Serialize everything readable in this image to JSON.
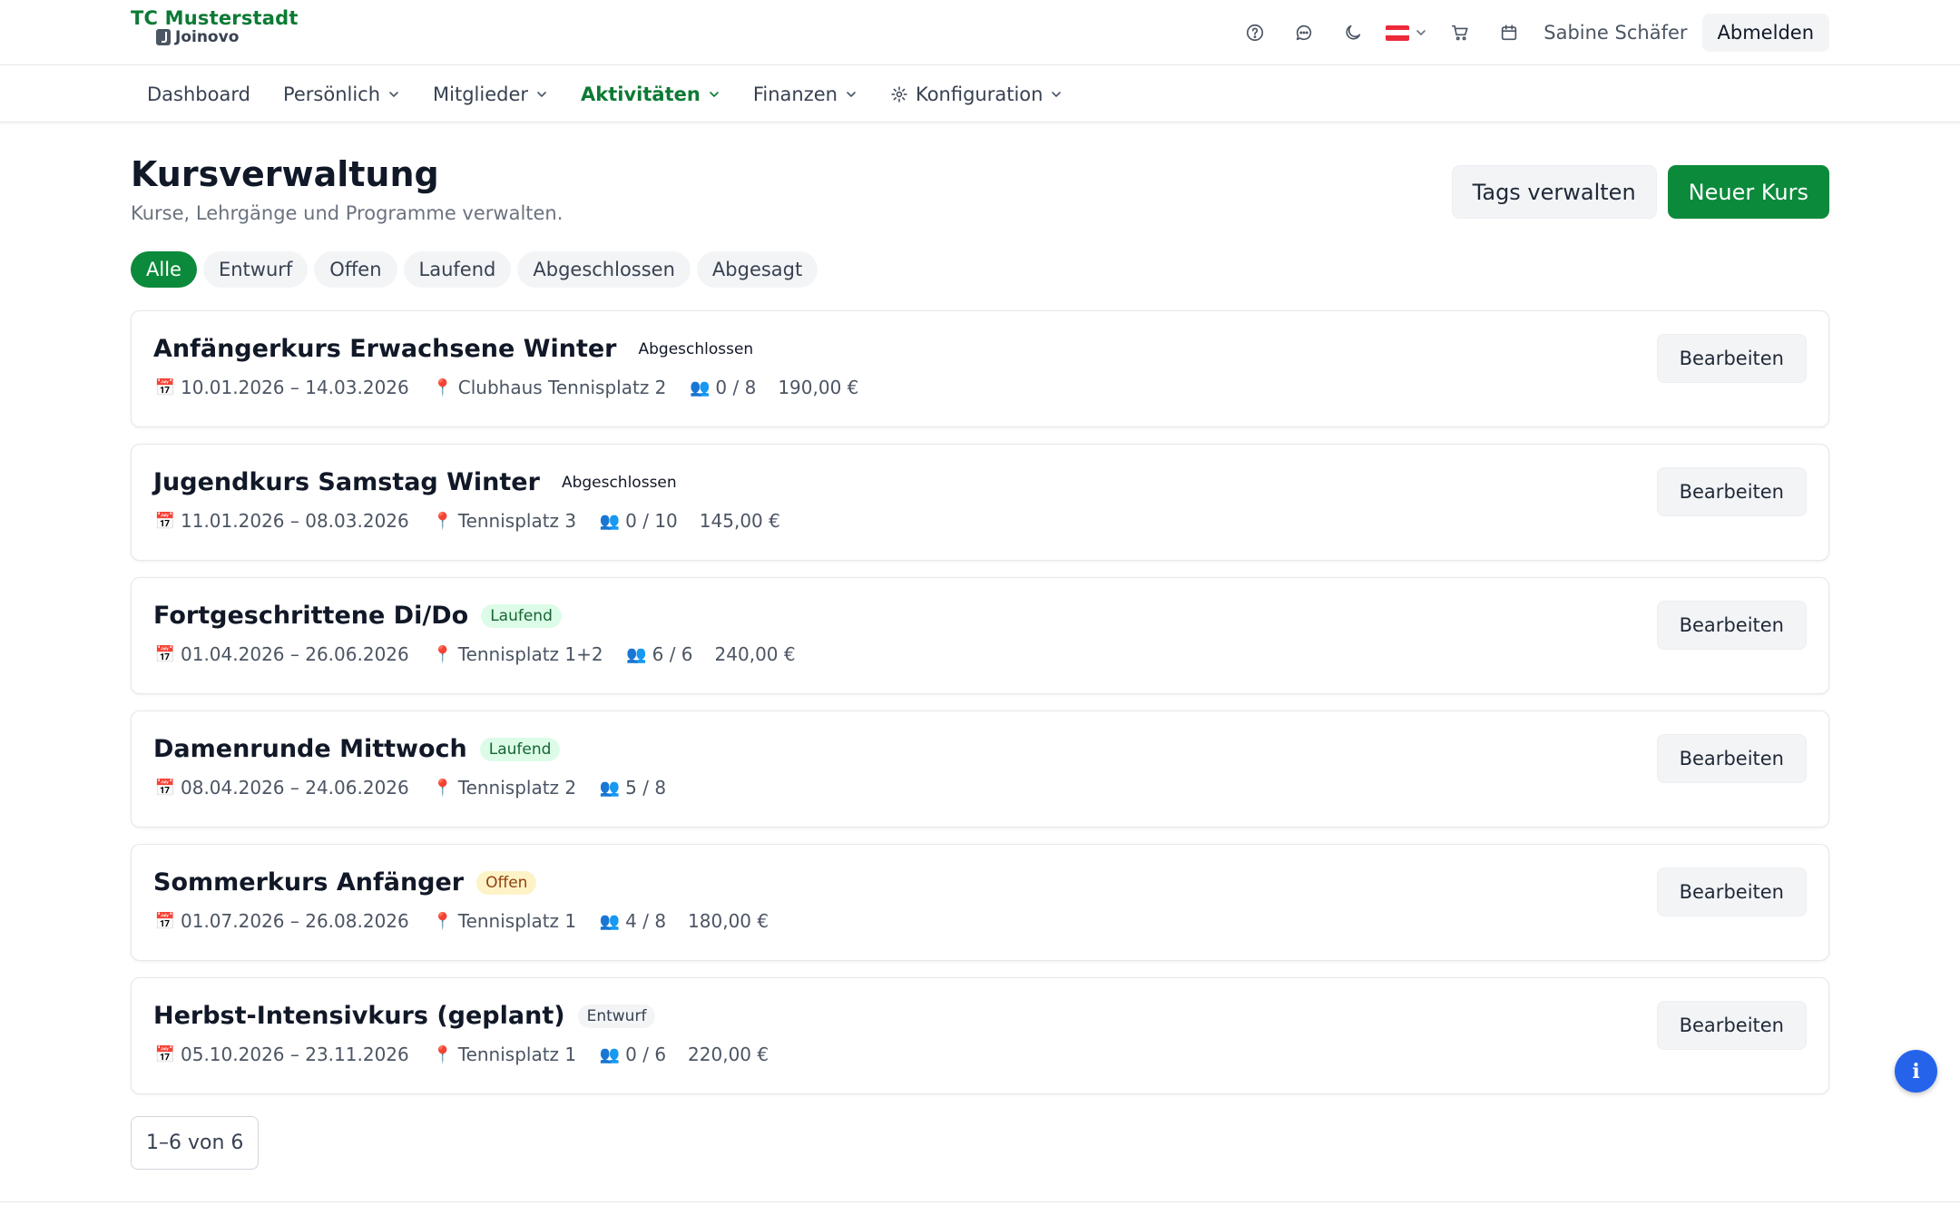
{
  "header": {
    "club_name": "TC Musterstadt",
    "platform_name": "Joinovo",
    "user_name": "Sabine Schäfer",
    "logout_label": "Abmelden",
    "icons": [
      "help-icon",
      "chat-icon",
      "dark-mode-icon",
      "language-flag-at",
      "cart-icon",
      "calendar-icon"
    ]
  },
  "nav": {
    "items": [
      {
        "label": "Dashboard",
        "dropdown": false,
        "active": false
      },
      {
        "label": "Persönlich",
        "dropdown": true,
        "active": false
      },
      {
        "label": "Mitglieder",
        "dropdown": true,
        "active": false
      },
      {
        "label": "Aktivitäten",
        "dropdown": true,
        "active": true
      },
      {
        "label": "Finanzen",
        "dropdown": true,
        "active": false
      },
      {
        "label": "Konfiguration",
        "dropdown": true,
        "active": false,
        "icon": "gear-icon"
      }
    ]
  },
  "page": {
    "title": "Kursverwaltung",
    "subtitle": "Kurse, Lehrgänge und Programme verwalten.",
    "manage_tags_label": "Tags verwalten",
    "new_course_label": "Neuer Kurs"
  },
  "filters": [
    {
      "label": "Alle",
      "active": true
    },
    {
      "label": "Entwurf",
      "active": false
    },
    {
      "label": "Offen",
      "active": false
    },
    {
      "label": "Laufend",
      "active": false
    },
    {
      "label": "Abgeschlossen",
      "active": false
    },
    {
      "label": "Abgesagt",
      "active": false
    }
  ],
  "courses": [
    {
      "title": "Anfängerkurs Erwachsene Winter",
      "status": "Abgeschlossen",
      "dates": "10.01.2026 – 14.03.2026",
      "location": "Clubhaus Tennisplatz 2",
      "participants": "0 / 8",
      "price": "190,00 €"
    },
    {
      "title": "Jugendkurs Samstag Winter",
      "status": "Abgeschlossen",
      "dates": "11.01.2026 – 08.03.2026",
      "location": "Tennisplatz 3",
      "participants": "0 / 10",
      "price": "145,00 €"
    },
    {
      "title": "Fortgeschrittene Di/Do",
      "status": "Laufend",
      "dates": "01.04.2026 – 26.06.2026",
      "location": "Tennisplatz 1+2",
      "participants": "6 / 6",
      "price": "240,00 €"
    },
    {
      "title": "Damenrunde Mittwoch",
      "status": "Laufend",
      "dates": "08.04.2026 – 24.06.2026",
      "location": "Tennisplatz 2",
      "participants": "5 / 8",
      "price": ""
    },
    {
      "title": "Sommerkurs Anfänger",
      "status": "Offen",
      "dates": "01.07.2026 – 26.08.2026",
      "location": "Tennisplatz 1",
      "participants": "4 / 8",
      "price": "180,00 €"
    },
    {
      "title": "Herbst-Intensivkurs (geplant)",
      "status": "Entwurf",
      "dates": "05.10.2026 – 23.11.2026",
      "location": "Tennisplatz 1",
      "participants": "0 / 6",
      "price": "220,00 €"
    }
  ],
  "edit_label": "Bearbeiten",
  "pagination": {
    "label": "1–6 von 6"
  },
  "info_button": {
    "label": "i"
  },
  "colors": {
    "brand_green": "#0b8a3b",
    "info_blue": "#2563eb"
  }
}
